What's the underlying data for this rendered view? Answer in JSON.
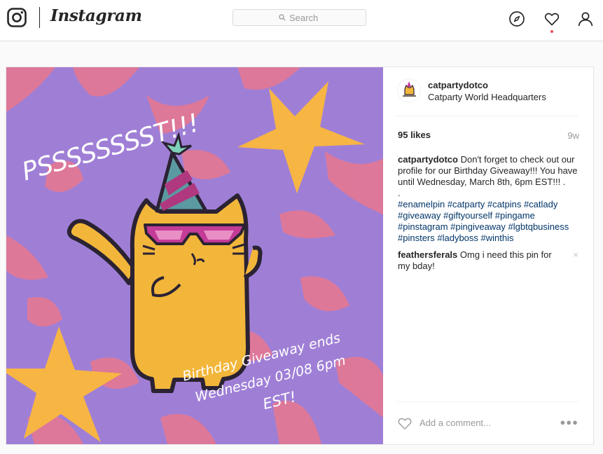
{
  "header": {
    "logo_text": "Instagram",
    "search": {
      "placeholder": "Search"
    },
    "icons": [
      "instagram-camera-icon",
      "search-icon",
      "compass-icon",
      "heart-icon",
      "profile-icon"
    ],
    "notification_dot_color": "#ed4956"
  },
  "post": {
    "image": {
      "headline": "PSSSSSSSST!!!",
      "giveaway_lines": [
        "Birthday Giveaway ends",
        "Wednesday 03/08 6pm",
        "EST!"
      ],
      "background_color": "#9f7fd6",
      "pattern_color": "#e8778f",
      "star_color": "#f7b543",
      "cat_color": "#f2b63a"
    },
    "author": {
      "username": "catpartydotco",
      "location": "Catparty World Headquarters"
    },
    "likes": "95 likes",
    "time_ago": "9w",
    "caption": {
      "username": "catpartydotco",
      "text": "Don't forget to check out our profile for our Birthday Giveaway!!! You have until Wednesday, March 8th, 6pm EST!!! .",
      "dot": ".",
      "hashtags": "#enamelpin #catparty #catpins #catlady #giveaway #giftyourself #pingame #pinstagram #pingiveaway #lgbtqbusiness #pinsters #ladyboss #winthis"
    },
    "comments": [
      {
        "username": "feathersferals",
        "text": "Omg i need this pin for my bday!",
        "delete_label": "×"
      }
    ],
    "add_comment": {
      "placeholder": "Add a comment...",
      "more_label": "●●●"
    },
    "link_color": "#003569"
  }
}
